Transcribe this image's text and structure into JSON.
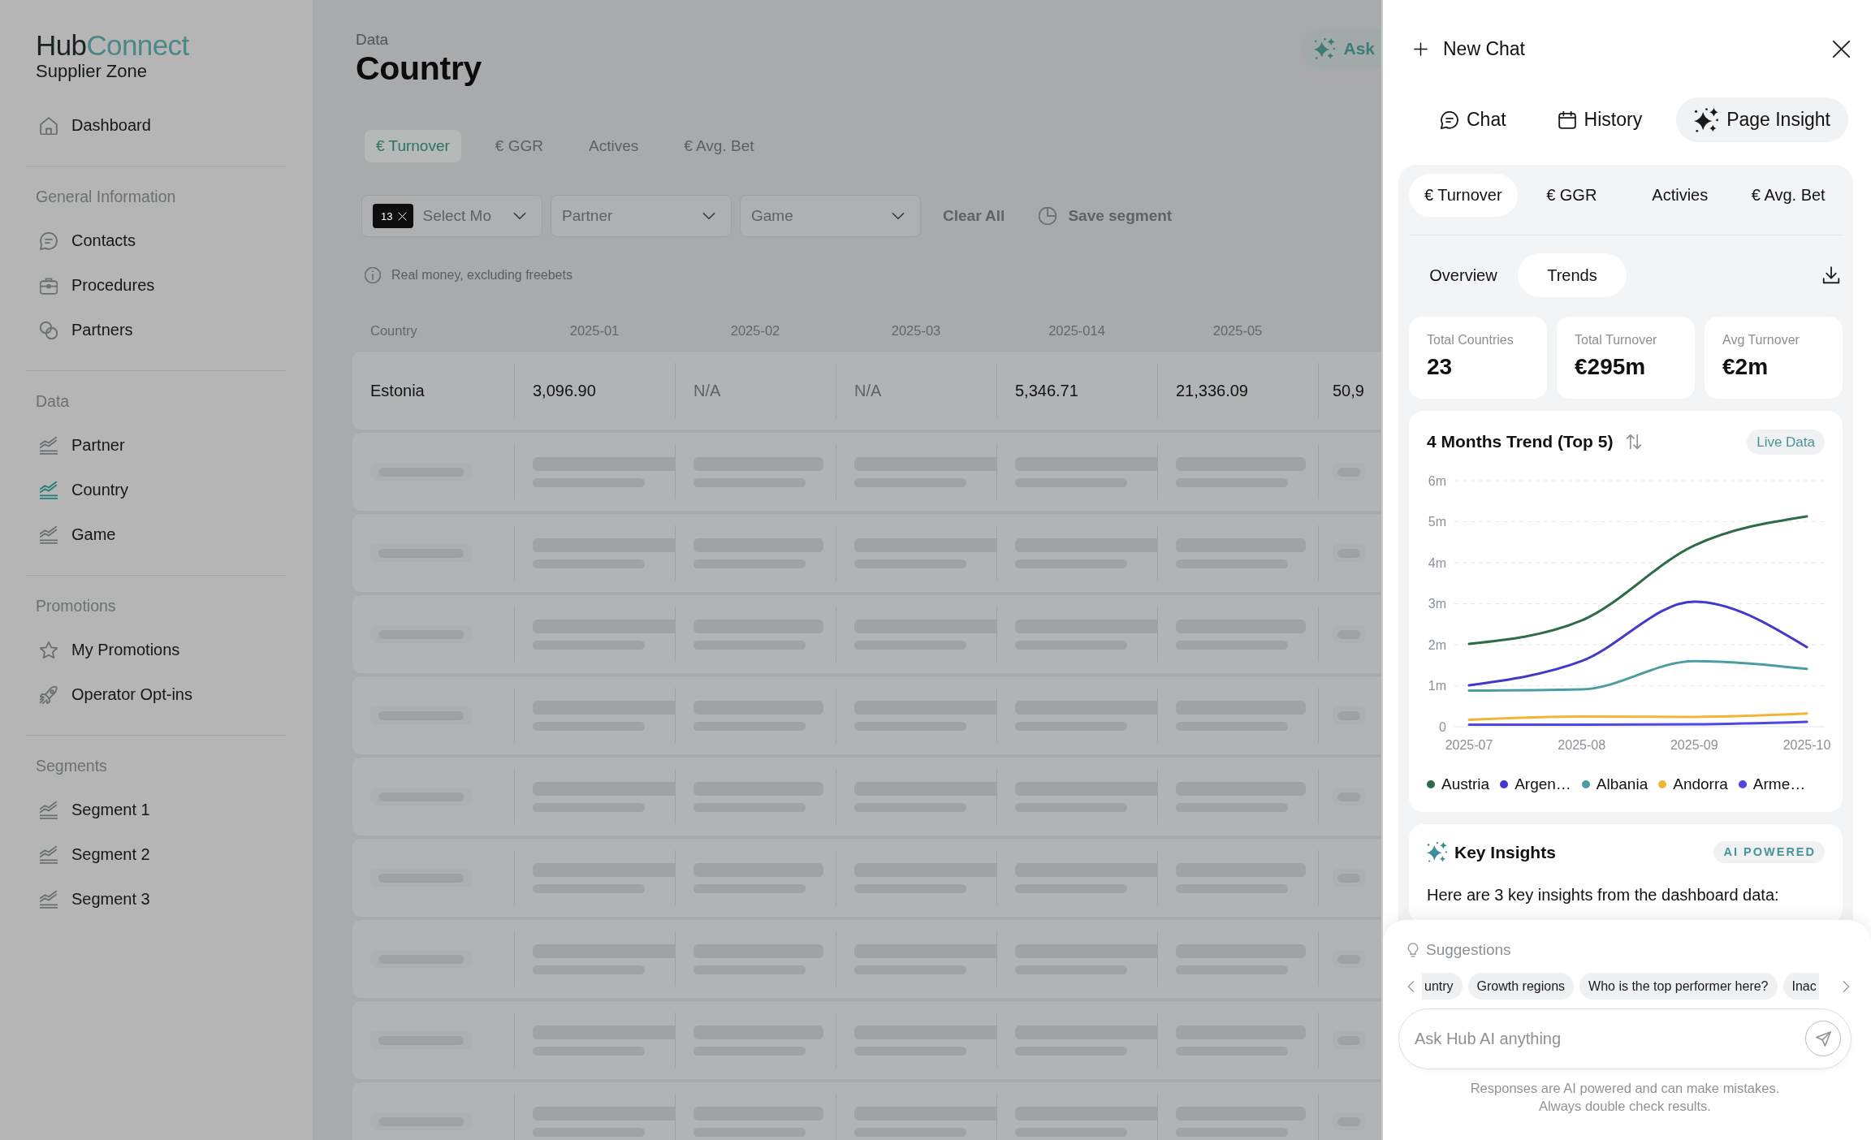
{
  "sidebar": {
    "logo": {
      "primary": "Hub",
      "accent": "Connect",
      "subtitle": "Supplier Zone"
    },
    "sections": [
      {
        "items": [
          {
            "label": "Dashboard",
            "selected": false
          }
        ]
      },
      {
        "heading": "General Information",
        "items": [
          {
            "label": "Contacts",
            "selected": false
          },
          {
            "label": "Procedures",
            "selected": false
          },
          {
            "label": "Partners",
            "selected": false
          }
        ]
      },
      {
        "heading": "Data",
        "items": [
          {
            "label": "Partner",
            "selected": false
          },
          {
            "label": "Country",
            "selected": true
          },
          {
            "label": "Game",
            "selected": false
          }
        ]
      },
      {
        "heading": "Promotions",
        "items": [
          {
            "label": "My Promotions",
            "selected": false
          },
          {
            "label": "Operator Opt-ins",
            "selected": false
          }
        ]
      },
      {
        "heading": "Segments",
        "items": [
          {
            "label": "Segment 1",
            "selected": false
          },
          {
            "label": "Segment 2",
            "selected": false
          },
          {
            "label": "Segment 3",
            "selected": false
          }
        ]
      }
    ]
  },
  "page_header": {
    "breadcrumb": "Data",
    "title": "Country",
    "ask_button": "Ask"
  },
  "metric_tabs": [
    {
      "label": "€ Turnover",
      "selected": true
    },
    {
      "label": "€ GGR",
      "selected": false
    },
    {
      "label": "Actives",
      "selected": false
    },
    {
      "label": "€ Avg. Bet",
      "selected": false
    }
  ],
  "filters": {
    "month_select": {
      "badge": "13",
      "placeholder": "Select Mo"
    },
    "partner_select": {
      "placeholder": "Partner"
    },
    "game_select": {
      "placeholder": "Game"
    },
    "clear_all": "Clear All",
    "save_segment": "Save segment"
  },
  "note": "Real money, excluding freebets",
  "table": {
    "columns": [
      "Country",
      "2025-01",
      "2025-02",
      "2025-03",
      "2025-014",
      "2025-05"
    ],
    "rows": [
      {
        "loading": false,
        "cells": [
          {
            "text": "Estonia",
            "available": true
          },
          {
            "text": "3,096.90",
            "available": true
          },
          {
            "text": "N/A",
            "available": false
          },
          {
            "text": "N/A",
            "available": false
          },
          {
            "text": "5,346.71",
            "available": true
          },
          {
            "text": "21,336.09",
            "available": true
          },
          {
            "text": "50,9",
            "available": true
          }
        ]
      },
      {
        "loading": true
      },
      {
        "loading": true
      },
      {
        "loading": true
      },
      {
        "loading": true
      },
      {
        "loading": true
      },
      {
        "loading": true
      },
      {
        "loading": true
      },
      {
        "loading": true
      },
      {
        "loading": true
      }
    ]
  },
  "assistant_panel": {
    "new_chat": "New Chat",
    "tabs": [
      {
        "label": "Chat",
        "selected": false
      },
      {
        "label": "History",
        "selected": false
      },
      {
        "label": "Page Insight",
        "selected": true
      }
    ],
    "metric_tabs": [
      {
        "label": "€ Turnover",
        "selected": true
      },
      {
        "label": "€ GGR",
        "selected": false
      },
      {
        "label": "Activies",
        "selected": false
      },
      {
        "label": "€ Avg. Bet",
        "selected": false
      }
    ],
    "view_tabs": [
      {
        "label": "Overview",
        "selected": false
      },
      {
        "label": "Trends",
        "selected": true
      }
    ],
    "stats": [
      {
        "label": "Total Countries",
        "value": "23"
      },
      {
        "label": "Total Turnover",
        "value": "€295m"
      },
      {
        "label": "Avg Turnover",
        "value": "€2m"
      }
    ],
    "trend_card": {
      "badge": "Live Data",
      "chart_data": {
        "type": "line",
        "title": "4 Months Trend (Top 5)",
        "categories": [
          "2025-07",
          "2025-08",
          "2025-09",
          "2025-10"
        ],
        "ylim": [
          0,
          6
        ],
        "yticks": [
          {
            "value": 0,
            "label": "0"
          },
          {
            "value": 1,
            "label": "1m"
          },
          {
            "value": 2,
            "label": "2m"
          },
          {
            "value": 3,
            "label": "3m"
          },
          {
            "value": 4,
            "label": "4m"
          },
          {
            "value": 5,
            "label": "5m"
          },
          {
            "value": 6,
            "label": "6m"
          }
        ],
        "grid": true,
        "legend": "bottom",
        "series": [
          {
            "name": "Austria",
            "color": "#2e6b47",
            "values": [
              2.02,
              2.59,
              4.42,
              5.13
            ]
          },
          {
            "name": "Argen…",
            "color": "#4338ca",
            "values": [
              1.01,
              1.6,
              3.05,
              1.94
            ]
          },
          {
            "name": "Albania",
            "color": "#4a9ea3",
            "values": [
              0.88,
              0.91,
              1.6,
              1.41
            ]
          },
          {
            "name": "Andorra",
            "color": "#f2b535",
            "values": [
              0.17,
              0.25,
              0.24,
              0.32
            ]
          },
          {
            "name": "Arme…",
            "color": "#4f46e5",
            "values": [
              0.05,
              0.05,
              0.06,
              0.12
            ]
          }
        ]
      }
    },
    "insights_card": {
      "title": "Key Insights",
      "badge": "AI POWERED",
      "intro": "Here are 3 key insights from the dashboard data:"
    },
    "suggestions": {
      "heading": "Suggestions",
      "chips": [
        "untry",
        "Growth regions",
        "Who is the top performer here?",
        "Inac"
      ]
    },
    "composer": {
      "placeholder": "Ask Hub AI anything"
    },
    "disclaimer": [
      "Responses are AI powered and can make mistakes.",
      "Always double check results."
    ]
  }
}
